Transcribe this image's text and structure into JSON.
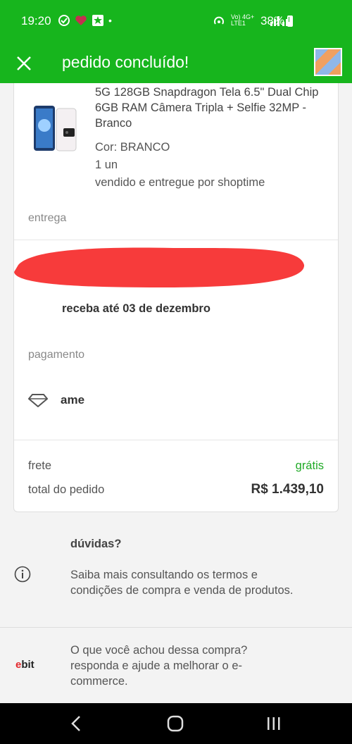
{
  "status_bar": {
    "time": "19:20",
    "network_labels": "Vo) 4G+ LTE1",
    "battery": "38%"
  },
  "header": {
    "title": "pedido concluído!",
    "close_icon": "close-icon",
    "avatar_icon": "avatar"
  },
  "product": {
    "name": "5G 128GB Snapdragon Tela 6.5\" Dual Chip 6GB RAM Câmera Tripla + Selfie 32MP - Branco",
    "color": "Cor: BRANCO",
    "quantity": "1 un",
    "seller": "vendido e entregue por shoptime"
  },
  "delivery": {
    "label": "entrega",
    "estimate": "receba até 03 de dezembro"
  },
  "payment": {
    "label": "pagamento",
    "method": "ame",
    "icon": "diamond-icon"
  },
  "summary": {
    "freight_label": "frete",
    "freight_value": "grátis",
    "total_label": "total do pedido",
    "total_value": "R$ 1.439,10"
  },
  "help": {
    "title": "dúvidas?",
    "text": "Saiba mais consultando os termos e condições de compra e venda de produtos.",
    "icon": "info-icon"
  },
  "feedback": {
    "logo": "ebit",
    "text": "O que você achou dessa compra? responda e ajude a melhorar o e-commerce."
  },
  "colors": {
    "brand_green": "#17b51d",
    "free_green": "#1faa26",
    "redaction_red": "#f73b3b"
  }
}
